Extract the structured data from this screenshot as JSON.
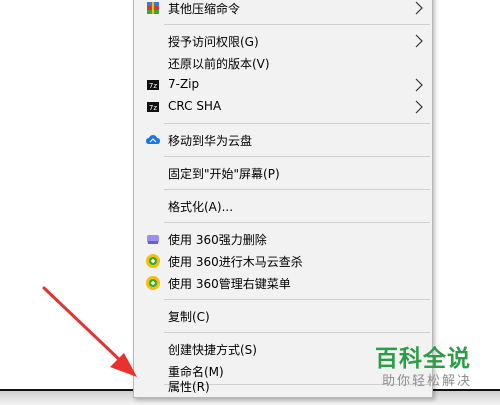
{
  "menu": {
    "items": [
      {
        "label": "其他压缩命令",
        "icon": "archive-stack-icon"
      },
      {
        "label": "授予访问权限(G)"
      },
      {
        "label": "还原以前的版本(V)"
      },
      {
        "label": "7-Zip",
        "icon": "7zip-icon"
      },
      {
        "label": "CRC SHA",
        "icon": "7zip-icon"
      },
      {
        "label": "移动到华为云盘",
        "icon": "cloud-icon"
      },
      {
        "label": "固定到\"开始\"屏幕(P)"
      },
      {
        "label": "格式化(A)..."
      },
      {
        "label": "使用 360强力删除",
        "icon": "360-shred-icon"
      },
      {
        "label": "使用 360进行木马云查杀",
        "icon": "360-scan-icon"
      },
      {
        "label": "使用 360管理右键菜单",
        "icon": "360-manage-icon"
      },
      {
        "label": "复制(C)"
      },
      {
        "label": "创建快捷方式(S)"
      },
      {
        "label": "重命名(M)"
      },
      {
        "label": "属性(R)"
      }
    ]
  },
  "watermark": {
    "title": "百科全说",
    "subtitle": "助你轻松解决"
  },
  "colors": {
    "menu_bg": "#f2f2f2",
    "arrow": "#e8322f",
    "watermark_green": "#2b9d47",
    "cloud_blue": "#1a73e8",
    "shield_yellow": "#f3c10a",
    "shield_green": "#3aa935"
  }
}
